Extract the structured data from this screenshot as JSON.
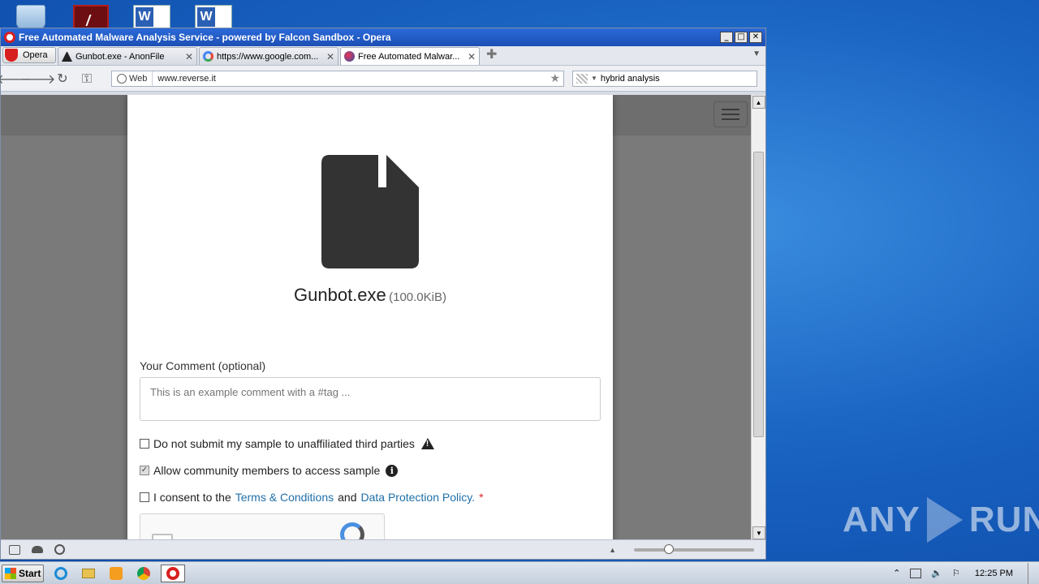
{
  "desktop": {
    "icons": [
      "recycle-bin",
      "adobe-acrobat",
      "word-document",
      "word-document"
    ],
    "watermark": "ANY RUN"
  },
  "window": {
    "title": "Free Automated Malware Analysis Service - powered by Falcon Sandbox - Opera",
    "controls": {
      "minimize": "_",
      "maximize": "□",
      "close": "✕"
    }
  },
  "tabbar": {
    "menu_label": "Opera",
    "tabs": [
      {
        "label": "Gunbot.exe - AnonFile",
        "active": false
      },
      {
        "label": "https://www.google.com...",
        "active": false
      },
      {
        "label": "Free Automated Malwar...",
        "active": true
      }
    ]
  },
  "addressbar": {
    "web_label": "Web",
    "url": "www.reverse.it",
    "search_value": "hybrid analysis"
  },
  "page": {
    "file_name": "Gunbot.exe",
    "file_size": "(100.0KiB)",
    "comment_label": "Your Comment (optional)",
    "comment_placeholder": "This is an example comment with a #tag ...",
    "no_submit_label": "Do not submit my sample to unaffiliated third parties",
    "community_label": "Allow community members to access sample",
    "community_checked": true,
    "consent_prefix": "I consent to the",
    "terms_link": "Terms & Conditions",
    "and_text": "and",
    "privacy_link": "Data Protection Policy.",
    "required_mark": "*"
  },
  "statusbar": {
    "zoom_level_fraction": 0.27
  },
  "taskbar": {
    "start_label": "Start",
    "apps": [
      "internet-explorer",
      "file-explorer",
      "media-player",
      "chrome",
      "opera"
    ],
    "clock": "12:25 PM"
  }
}
